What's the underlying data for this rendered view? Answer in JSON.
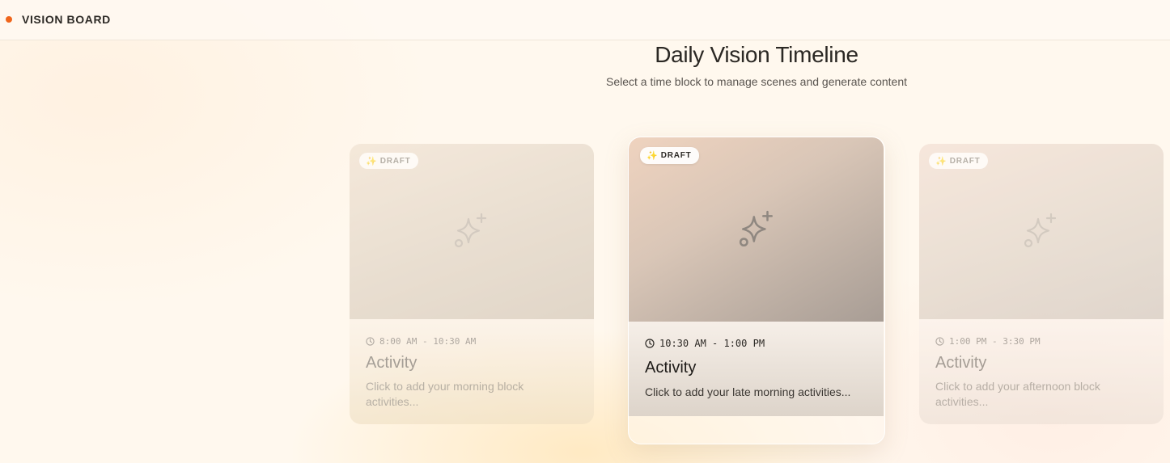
{
  "header": {
    "title": "VISION BOARD",
    "accent_color": "#f0651b"
  },
  "page": {
    "title": "Daily Vision Timeline",
    "subtitle": "Select a time block to manage scenes and generate content"
  },
  "cards": [
    {
      "status": "DRAFT",
      "status_icon": "sparkle-emoji",
      "placeholder_icon": "sparkle-plus-icon",
      "time": "8:00 AM - 10:30 AM",
      "title": "Activity",
      "description": "Click to add your morning block activities...",
      "selected": false
    },
    {
      "status": "DRAFT",
      "status_icon": "sparkle-emoji",
      "placeholder_icon": "sparkle-plus-icon",
      "time": "10:30 AM - 1:00 PM",
      "title": "Activity",
      "description": "Click to add your late morning activities...",
      "selected": true
    },
    {
      "status": "DRAFT",
      "status_icon": "sparkle-emoji",
      "placeholder_icon": "sparkle-plus-icon",
      "time": "1:00 PM - 3:30 PM",
      "title": "Activity",
      "description": "Click to add your afternoon block activities...",
      "selected": false
    }
  ]
}
